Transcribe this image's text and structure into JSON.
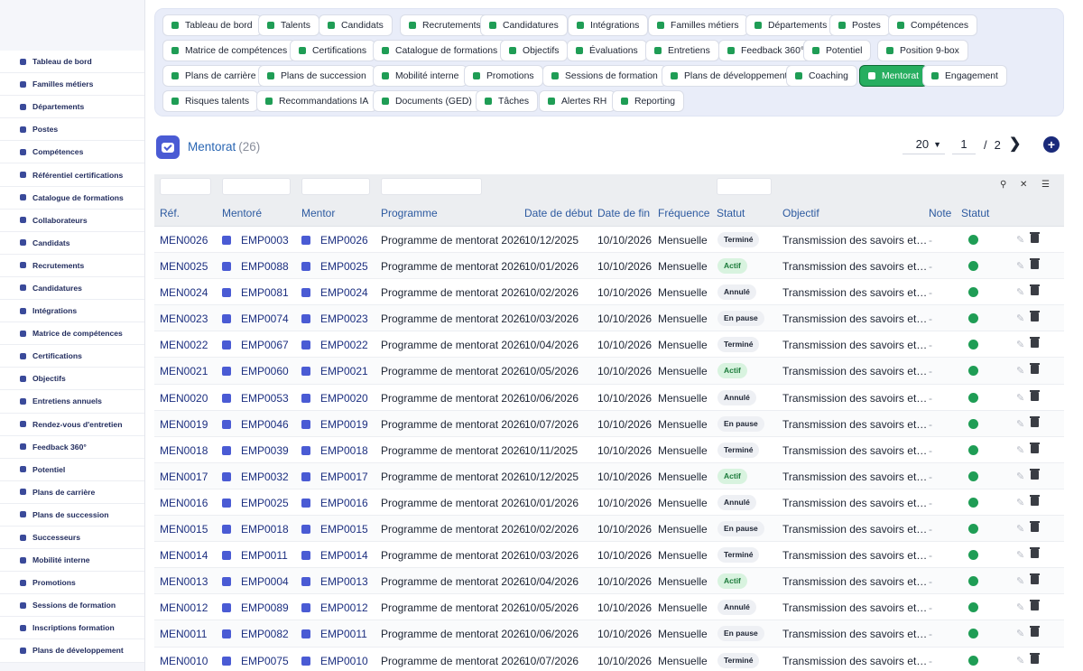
{
  "sidebar": {
    "items": [
      {
        "label": "Tableau de bord",
        "icon": "dashboard-icon"
      },
      {
        "label": "Familles métiers",
        "icon": "sitemap-icon"
      },
      {
        "label": "Départements",
        "icon": "building-icon"
      },
      {
        "label": "Postes",
        "icon": "id-badge-icon"
      },
      {
        "label": "Compétences",
        "icon": "brain-icon"
      },
      {
        "label": "Référentiel certifications",
        "icon": "certificate-icon"
      },
      {
        "label": "Catalogue de formations",
        "icon": "graduation-cap-icon"
      },
      {
        "label": "Collaborateurs",
        "icon": "user-icon"
      },
      {
        "label": "Candidats",
        "icon": "user-plus-icon"
      },
      {
        "label": "Recrutements",
        "icon": "megaphone-icon"
      },
      {
        "label": "Candidatures",
        "icon": "file-signature-icon"
      },
      {
        "label": "Intégrations",
        "icon": "door-open-icon"
      },
      {
        "label": "Matrice de compétences",
        "icon": "sitemap-icon"
      },
      {
        "label": "Certifications",
        "icon": "award-icon"
      },
      {
        "label": "Objectifs",
        "icon": "target-icon"
      },
      {
        "label": "Entretiens annuels",
        "icon": "star-half-icon"
      },
      {
        "label": "Rendez-vous d'entretien",
        "icon": "comments-icon"
      },
      {
        "label": "Feedback 360°",
        "icon": "comment-dots-icon"
      },
      {
        "label": "Potentiel",
        "icon": "chart-line-icon"
      },
      {
        "label": "Plans de carrière",
        "icon": "route-icon"
      },
      {
        "label": "Plans de succession",
        "icon": "sitemap-icon"
      },
      {
        "label": "Successeurs",
        "icon": "users-icon"
      },
      {
        "label": "Mobilité interne",
        "icon": "exchange-icon"
      },
      {
        "label": "Promotions",
        "icon": "arrow-up-icon"
      },
      {
        "label": "Sessions de formation",
        "icon": "chalkboard-icon"
      },
      {
        "label": "Inscriptions formation",
        "icon": "user-graduate-icon"
      },
      {
        "label": "Plans de développement",
        "icon": "clipboard-icon"
      }
    ]
  },
  "modules": [
    {
      "label": "Tableau de bord",
      "icon": "dashboard-icon"
    },
    {
      "label": "Talents",
      "icon": "user-tie-icon"
    },
    {
      "label": "Candidats",
      "icon": "user-plus-icon"
    },
    {
      "label": "Recrutements",
      "icon": "megaphone-icon"
    },
    {
      "label": "Candidatures",
      "icon": "file-signature-icon"
    },
    {
      "label": "Intégrations",
      "icon": "door-open-icon"
    },
    {
      "label": "Familles métiers",
      "icon": "sitemap-icon"
    },
    {
      "label": "Départements",
      "icon": "building-icon"
    },
    {
      "label": "Postes",
      "icon": "id-badge-icon"
    },
    {
      "label": "Compétences",
      "icon": "brain-icon"
    },
    {
      "label": "Matrice de compétences",
      "icon": "sitemap-icon"
    },
    {
      "label": "Certifications",
      "icon": "award-icon"
    },
    {
      "label": "Catalogue de formations",
      "icon": "graduation-cap-icon"
    },
    {
      "label": "Objectifs",
      "icon": "target-icon"
    },
    {
      "label": "Évaluations",
      "icon": "star-half-icon"
    },
    {
      "label": "Entretiens",
      "icon": "comments-icon"
    },
    {
      "label": "Feedback 360°",
      "icon": "comment-dots-icon"
    },
    {
      "label": "Potentiel",
      "icon": "chart-line-icon"
    },
    {
      "label": "Position 9-box",
      "icon": "grid-icon"
    },
    {
      "label": "Plans de carrière",
      "icon": "route-icon"
    },
    {
      "label": "Plans de succession",
      "icon": "sitemap-icon"
    },
    {
      "label": "Mobilité interne",
      "icon": "exchange-icon"
    },
    {
      "label": "Promotions",
      "icon": "arrow-up-icon"
    },
    {
      "label": "Sessions de formation",
      "icon": "chalkboard-icon"
    },
    {
      "label": "Plans de développement",
      "icon": "clipboard-icon"
    },
    {
      "label": "Coaching",
      "icon": "handshake-icon"
    },
    {
      "label": "Mentorat",
      "icon": "hourglass-icon",
      "active": true
    },
    {
      "label": "Engagement",
      "icon": "heart-icon"
    },
    {
      "label": "Risques talents",
      "icon": "warning-icon"
    },
    {
      "label": "Recommandations IA",
      "icon": "robot-icon"
    },
    {
      "label": "Documents (GED)",
      "icon": "folder-icon"
    },
    {
      "label": "Tâches",
      "icon": "tasks-icon"
    },
    {
      "label": "Alertes RH",
      "icon": "bell-icon"
    },
    {
      "label": "Reporting",
      "icon": "chart-pie-icon"
    }
  ],
  "header": {
    "title": "Mentorat",
    "count": "(26)",
    "per_page": "20",
    "page": "1",
    "page_sep": "/",
    "total_pages": "2",
    "next_symbol": "❯",
    "add_symbol": "+"
  },
  "table": {
    "columns": [
      "Réf.",
      "Mentoré",
      "Mentor",
      "Programme",
      "Date de début",
      "Date de fin",
      "Fréquence",
      "Statut",
      "Objectif",
      "Note",
      "Statut"
    ],
    "rows": [
      {
        "ref": "MEN0026",
        "mentore": "EMP0003",
        "mentor": "EMP0026",
        "programme": "Programme de mentorat 2026",
        "debut": "10/12/2025",
        "fin": "10/10/2026",
        "frequence": "Mensuelle",
        "statut": "Terminé",
        "objectif": "Transmission des savoirs et…",
        "note": "-"
      },
      {
        "ref": "MEN0025",
        "mentore": "EMP0088",
        "mentor": "EMP0025",
        "programme": "Programme de mentorat 2026",
        "debut": "10/01/2026",
        "fin": "10/10/2026",
        "frequence": "Mensuelle",
        "statut": "Actif",
        "objectif": "Transmission des savoirs et…",
        "note": "-"
      },
      {
        "ref": "MEN0024",
        "mentore": "EMP0081",
        "mentor": "EMP0024",
        "programme": "Programme de mentorat 2026",
        "debut": "10/02/2026",
        "fin": "10/10/2026",
        "frequence": "Mensuelle",
        "statut": "Annulé",
        "objectif": "Transmission des savoirs et…",
        "note": "-"
      },
      {
        "ref": "MEN0023",
        "mentore": "EMP0074",
        "mentor": "EMP0023",
        "programme": "Programme de mentorat 2026",
        "debut": "10/03/2026",
        "fin": "10/10/2026",
        "frequence": "Mensuelle",
        "statut": "En pause",
        "objectif": "Transmission des savoirs et…",
        "note": "-"
      },
      {
        "ref": "MEN0022",
        "mentore": "EMP0067",
        "mentor": "EMP0022",
        "programme": "Programme de mentorat 2026",
        "debut": "10/04/2026",
        "fin": "10/10/2026",
        "frequence": "Mensuelle",
        "statut": "Terminé",
        "objectif": "Transmission des savoirs et…",
        "note": "-"
      },
      {
        "ref": "MEN0021",
        "mentore": "EMP0060",
        "mentor": "EMP0021",
        "programme": "Programme de mentorat 2026",
        "debut": "10/05/2026",
        "fin": "10/10/2026",
        "frequence": "Mensuelle",
        "statut": "Actif",
        "objectif": "Transmission des savoirs et…",
        "note": "-"
      },
      {
        "ref": "MEN0020",
        "mentore": "EMP0053",
        "mentor": "EMP0020",
        "programme": "Programme de mentorat 2026",
        "debut": "10/06/2026",
        "fin": "10/10/2026",
        "frequence": "Mensuelle",
        "statut": "Annulé",
        "objectif": "Transmission des savoirs et…",
        "note": "-"
      },
      {
        "ref": "MEN0019",
        "mentore": "EMP0046",
        "mentor": "EMP0019",
        "programme": "Programme de mentorat 2026",
        "debut": "10/07/2026",
        "fin": "10/10/2026",
        "frequence": "Mensuelle",
        "statut": "En pause",
        "objectif": "Transmission des savoirs et…",
        "note": "-"
      },
      {
        "ref": "MEN0018",
        "mentore": "EMP0039",
        "mentor": "EMP0018",
        "programme": "Programme de mentorat 2026",
        "debut": "10/11/2025",
        "fin": "10/10/2026",
        "frequence": "Mensuelle",
        "statut": "Terminé",
        "objectif": "Transmission des savoirs et…",
        "note": "-"
      },
      {
        "ref": "MEN0017",
        "mentore": "EMP0032",
        "mentor": "EMP0017",
        "programme": "Programme de mentorat 2026",
        "debut": "10/12/2025",
        "fin": "10/10/2026",
        "frequence": "Mensuelle",
        "statut": "Actif",
        "objectif": "Transmission des savoirs et…",
        "note": "-"
      },
      {
        "ref": "MEN0016",
        "mentore": "EMP0025",
        "mentor": "EMP0016",
        "programme": "Programme de mentorat 2026",
        "debut": "10/01/2026",
        "fin": "10/10/2026",
        "frequence": "Mensuelle",
        "statut": "Annulé",
        "objectif": "Transmission des savoirs et…",
        "note": "-"
      },
      {
        "ref": "MEN0015",
        "mentore": "EMP0018",
        "mentor": "EMP0015",
        "programme": "Programme de mentorat 2026",
        "debut": "10/02/2026",
        "fin": "10/10/2026",
        "frequence": "Mensuelle",
        "statut": "En pause",
        "objectif": "Transmission des savoirs et…",
        "note": "-"
      },
      {
        "ref": "MEN0014",
        "mentore": "EMP0011",
        "mentor": "EMP0014",
        "programme": "Programme de mentorat 2026",
        "debut": "10/03/2026",
        "fin": "10/10/2026",
        "frequence": "Mensuelle",
        "statut": "Terminé",
        "objectif": "Transmission des savoirs et…",
        "note": "-"
      },
      {
        "ref": "MEN0013",
        "mentore": "EMP0004",
        "mentor": "EMP0013",
        "programme": "Programme de mentorat 2026",
        "debut": "10/04/2026",
        "fin": "10/10/2026",
        "frequence": "Mensuelle",
        "statut": "Actif",
        "objectif": "Transmission des savoirs et…",
        "note": "-"
      },
      {
        "ref": "MEN0012",
        "mentore": "EMP0089",
        "mentor": "EMP0012",
        "programme": "Programme de mentorat 2026",
        "debut": "10/05/2026",
        "fin": "10/10/2026",
        "frequence": "Mensuelle",
        "statut": "Annulé",
        "objectif": "Transmission des savoirs et…",
        "note": "-"
      },
      {
        "ref": "MEN0011",
        "mentore": "EMP0082",
        "mentor": "EMP0011",
        "programme": "Programme de mentorat 2026",
        "debut": "10/06/2026",
        "fin": "10/10/2026",
        "frequence": "Mensuelle",
        "statut": "En pause",
        "objectif": "Transmission des savoirs et…",
        "note": "-"
      },
      {
        "ref": "MEN0010",
        "mentore": "EMP0075",
        "mentor": "EMP0010",
        "programme": "Programme de mentorat 2026",
        "debut": "10/07/2026",
        "fin": "10/10/2026",
        "frequence": "Mensuelle",
        "statut": "Terminé",
        "objectif": "Transmission des savoirs et…",
        "note": "-"
      }
    ]
  },
  "colors": {
    "accent_green": "#27ae60",
    "status_dot": "#1f9d55",
    "link_blue": "#1c2f80",
    "header_blue": "#2d5aa0",
    "primary": "#4a5bd4"
  }
}
